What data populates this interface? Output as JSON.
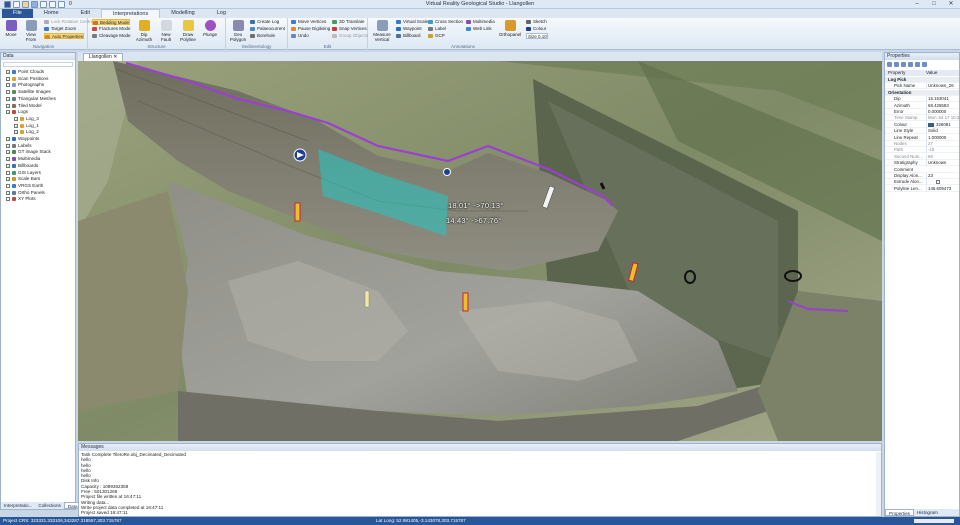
{
  "app": {
    "title": "Virtual Reality Geological Studio - Llangollen",
    "qat_value": "0"
  },
  "tabs": [
    {
      "label": "File"
    },
    {
      "label": "Home"
    },
    {
      "label": "Edit"
    },
    {
      "label": "Interpretations",
      "active": true
    },
    {
      "label": "Modelling"
    },
    {
      "label": "Log"
    }
  ],
  "ribbon": {
    "nav": {
      "move": "Move",
      "view_from": "View From",
      "lock_rotation": "Lock Rotation Centre",
      "target_zoom": "Target Zoom",
      "auto_properties": "Auto Properties",
      "label": "Navigation"
    },
    "structure": {
      "bedding_mode": "Bedding Mode",
      "fractures_mode": "Fractures Mode",
      "cleavage_mode": "Cleavage Mode",
      "dip_azimuth": "Dip Azimuth",
      "new_fault": "New Fault",
      "draw_polyline": "Draw Polyline",
      "plunge": "Plunge",
      "label": "Structure"
    },
    "sedimentology": {
      "geo_polygon": "Geo Polygon",
      "create_log": "Create Log",
      "palaeocurrent": "Palaeocurrent",
      "borehole": "Borehole",
      "label": "Sedimentology"
    },
    "edit": {
      "move_vertices": "Move Vertices",
      "pause_digitising": "Pause Digitising",
      "undo": "Undo",
      "translate_3d": "3D Translate",
      "snap_vertices": "Snap Vertices",
      "group_objects": "Group Objects",
      "label": "Edit"
    },
    "annotations": {
      "measure_vertical": "Measure Vertical",
      "virtual_scale": "Virtual Scale",
      "waypoint": "Waypoint",
      "billboard": "Billboard",
      "cross_section": "Cross Section",
      "label_btn": "Label",
      "gcp": "GCP",
      "multimedia": "Multimedia",
      "web_link": "Web Link",
      "orthopanel": "Orthopanel",
      "sketch": "Sketch",
      "colour": "Colour",
      "size": "Size 0.10",
      "label": "Annotations"
    }
  },
  "left_panel": {
    "title": "Data",
    "items": [
      {
        "label": "Point Clouds",
        "level": 0,
        "checked": true,
        "color": "#3a7bd5"
      },
      {
        "label": "Scan Positions",
        "level": 0,
        "checked": false,
        "color": "#e0a030"
      },
      {
        "label": "Photographs",
        "level": 0,
        "checked": false,
        "color": "#7aa0c8"
      },
      {
        "label": "Satellite Images",
        "level": 0,
        "checked": false,
        "color": "#5b8c5a"
      },
      {
        "label": "Triangular Meshes",
        "level": 0,
        "checked": true,
        "color": "#6b7a8f"
      },
      {
        "label": "Tiled Model",
        "level": 0,
        "checked": true,
        "color": "#8a6e4b"
      },
      {
        "label": "Logs",
        "level": 0,
        "checked": true,
        "color": "#c24a3a"
      },
      {
        "label": "Log_3",
        "level": 1,
        "checked": true,
        "color": "#d8a030"
      },
      {
        "label": "Log_1",
        "level": 1,
        "checked": true,
        "color": "#d8a030"
      },
      {
        "label": "Log_2",
        "level": 1,
        "checked": true,
        "color": "#d8a030"
      },
      {
        "label": "Waypoints",
        "level": 0,
        "checked": true,
        "color": "#2d6fc8"
      },
      {
        "label": "Labels",
        "level": 0,
        "checked": true,
        "color": "#777777"
      },
      {
        "label": "GT image Stack",
        "level": 0,
        "checked": true,
        "color": "#4a8a4a"
      },
      {
        "label": "Multimedia",
        "level": 0,
        "checked": true,
        "color": "#8a4ab0"
      },
      {
        "label": "Billboards",
        "level": 0,
        "checked": true,
        "color": "#3a6fb0"
      },
      {
        "label": "GIS Layers",
        "level": 0,
        "checked": false,
        "color": "#3f9a6a"
      },
      {
        "label": "Scale Bars",
        "level": 0,
        "checked": true,
        "color": "#c89a30"
      },
      {
        "label": "VRGS Earth",
        "level": 0,
        "checked": false,
        "color": "#2f7fd0"
      },
      {
        "label": "Ortho Panels",
        "level": 0,
        "checked": true,
        "color": "#5a7a9a"
      },
      {
        "label": "XY Plots",
        "level": 0,
        "checked": false,
        "color": "#c04848"
      }
    ],
    "tabs": [
      "Interpretatio...",
      "Collections",
      "Data"
    ]
  },
  "viewport": {
    "doc_tab": "Llangollen",
    "labels": [
      "18.01° ->70.13°",
      "14.43° ->67.76°"
    ],
    "colors": {
      "bedding": "#9b3fd4",
      "polygon": "#22c9c4",
      "waypoint": "#1e3f8f"
    }
  },
  "console": {
    "title": "Messages",
    "lines": [
      "Task Complete TileIoRe.obj_Decimated_Decimated",
      "hello",
      "hello",
      "hello",
      "hello",
      "Disk Info",
      "Capacity : 1099362358",
      "Free      : 501301268",
      "Project file written at 16:47:11",
      "Writing data...",
      "Write project data completed at 16:47:11",
      "Project saved 16:47:11",
      "Opened: C:\\Users\\ricoood\\1\\Documents\\TEMP\\Llangollen Data D4110\\VRGS\\LlangollenDecimated.obj"
    ]
  },
  "properties": {
    "title": "Properties",
    "col_property": "Property",
    "col_value": "Value",
    "rows": [
      {
        "name": "Log Pick",
        "value": "",
        "cat": true
      },
      {
        "name": "Pick Name",
        "value": "Unknown_26"
      },
      {
        "name": "Orientation",
        "value": "",
        "cat": true
      },
      {
        "name": "Dip",
        "value": "15.153041"
      },
      {
        "name": "Azimuth",
        "value": "68.425583"
      },
      {
        "name": "Error",
        "value": "0.000000"
      },
      {
        "name": "Time Stamp",
        "value": "Mon Jul 17 10:3...",
        "dim": true
      },
      {
        "name": "Colour",
        "value": "326081",
        "swatch": "#326081"
      },
      {
        "name": "Line Style",
        "value": "Solid"
      },
      {
        "name": "Line Repeat",
        "value": "1.000000"
      },
      {
        "name": "Nodes",
        "value": "27",
        "dim": true
      },
      {
        "name": "Path",
        "value": "-15",
        "dim": true
      },
      {
        "name": "Second Num...",
        "value": "66",
        "dim": true
      },
      {
        "name": "Stratigraphy",
        "value": "Unknown"
      },
      {
        "name": "Comment",
        "value": ""
      },
      {
        "name": "Display Alon...",
        "value": "23"
      },
      {
        "name": "Extrude Alon...",
        "value": "",
        "checkbox": true
      },
      {
        "name": "Polyline Len...",
        "value": "146.609473"
      }
    ],
    "tabs": [
      "Properties",
      "Histogram"
    ]
  },
  "status": {
    "left": "Project CRS: 323331.333106,343287.318557,303.715787",
    "mid": "Lat Long: 52.981405,-3.143078,303.715787"
  }
}
